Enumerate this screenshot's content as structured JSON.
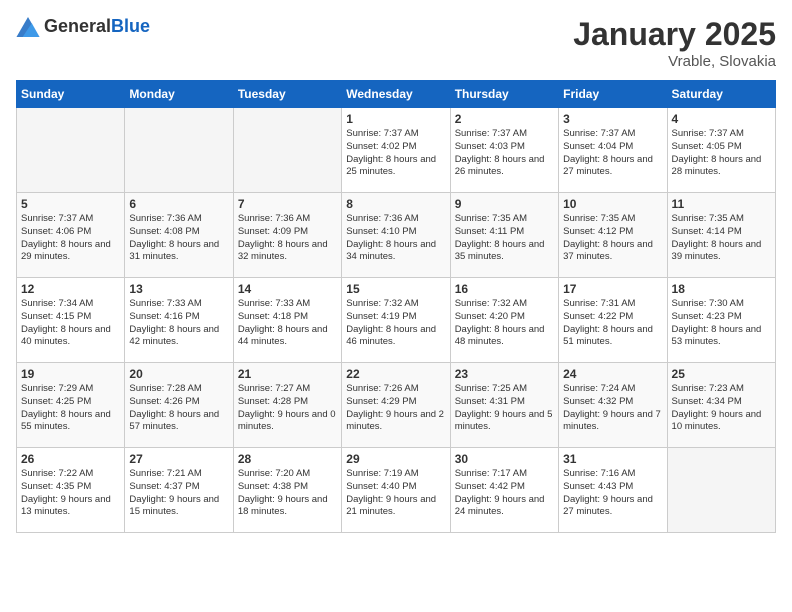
{
  "header": {
    "logo_general": "General",
    "logo_blue": "Blue",
    "title": "January 2025",
    "subtitle": "Vrable, Slovakia"
  },
  "columns": [
    "Sunday",
    "Monday",
    "Tuesday",
    "Wednesday",
    "Thursday",
    "Friday",
    "Saturday"
  ],
  "weeks": [
    [
      {
        "day": "",
        "empty": true
      },
      {
        "day": "",
        "empty": true
      },
      {
        "day": "",
        "empty": true
      },
      {
        "day": "1",
        "sunrise": "7:37 AM",
        "sunset": "4:02 PM",
        "daylight": "8 hours and 25 minutes."
      },
      {
        "day": "2",
        "sunrise": "7:37 AM",
        "sunset": "4:03 PM",
        "daylight": "8 hours and 26 minutes."
      },
      {
        "day": "3",
        "sunrise": "7:37 AM",
        "sunset": "4:04 PM",
        "daylight": "8 hours and 27 minutes."
      },
      {
        "day": "4",
        "sunrise": "7:37 AM",
        "sunset": "4:05 PM",
        "daylight": "8 hours and 28 minutes."
      }
    ],
    [
      {
        "day": "5",
        "sunrise": "7:37 AM",
        "sunset": "4:06 PM",
        "daylight": "8 hours and 29 minutes."
      },
      {
        "day": "6",
        "sunrise": "7:36 AM",
        "sunset": "4:08 PM",
        "daylight": "8 hours and 31 minutes."
      },
      {
        "day": "7",
        "sunrise": "7:36 AM",
        "sunset": "4:09 PM",
        "daylight": "8 hours and 32 minutes."
      },
      {
        "day": "8",
        "sunrise": "7:36 AM",
        "sunset": "4:10 PM",
        "daylight": "8 hours and 34 minutes."
      },
      {
        "day": "9",
        "sunrise": "7:35 AM",
        "sunset": "4:11 PM",
        "daylight": "8 hours and 35 minutes."
      },
      {
        "day": "10",
        "sunrise": "7:35 AM",
        "sunset": "4:12 PM",
        "daylight": "8 hours and 37 minutes."
      },
      {
        "day": "11",
        "sunrise": "7:35 AM",
        "sunset": "4:14 PM",
        "daylight": "8 hours and 39 minutes."
      }
    ],
    [
      {
        "day": "12",
        "sunrise": "7:34 AM",
        "sunset": "4:15 PM",
        "daylight": "8 hours and 40 minutes."
      },
      {
        "day": "13",
        "sunrise": "7:33 AM",
        "sunset": "4:16 PM",
        "daylight": "8 hours and 42 minutes."
      },
      {
        "day": "14",
        "sunrise": "7:33 AM",
        "sunset": "4:18 PM",
        "daylight": "8 hours and 44 minutes."
      },
      {
        "day": "15",
        "sunrise": "7:32 AM",
        "sunset": "4:19 PM",
        "daylight": "8 hours and 46 minutes."
      },
      {
        "day": "16",
        "sunrise": "7:32 AM",
        "sunset": "4:20 PM",
        "daylight": "8 hours and 48 minutes."
      },
      {
        "day": "17",
        "sunrise": "7:31 AM",
        "sunset": "4:22 PM",
        "daylight": "8 hours and 51 minutes."
      },
      {
        "day": "18",
        "sunrise": "7:30 AM",
        "sunset": "4:23 PM",
        "daylight": "8 hours and 53 minutes."
      }
    ],
    [
      {
        "day": "19",
        "sunrise": "7:29 AM",
        "sunset": "4:25 PM",
        "daylight": "8 hours and 55 minutes."
      },
      {
        "day": "20",
        "sunrise": "7:28 AM",
        "sunset": "4:26 PM",
        "daylight": "8 hours and 57 minutes."
      },
      {
        "day": "21",
        "sunrise": "7:27 AM",
        "sunset": "4:28 PM",
        "daylight": "9 hours and 0 minutes."
      },
      {
        "day": "22",
        "sunrise": "7:26 AM",
        "sunset": "4:29 PM",
        "daylight": "9 hours and 2 minutes."
      },
      {
        "day": "23",
        "sunrise": "7:25 AM",
        "sunset": "4:31 PM",
        "daylight": "9 hours and 5 minutes."
      },
      {
        "day": "24",
        "sunrise": "7:24 AM",
        "sunset": "4:32 PM",
        "daylight": "9 hours and 7 minutes."
      },
      {
        "day": "25",
        "sunrise": "7:23 AM",
        "sunset": "4:34 PM",
        "daylight": "9 hours and 10 minutes."
      }
    ],
    [
      {
        "day": "26",
        "sunrise": "7:22 AM",
        "sunset": "4:35 PM",
        "daylight": "9 hours and 13 minutes."
      },
      {
        "day": "27",
        "sunrise": "7:21 AM",
        "sunset": "4:37 PM",
        "daylight": "9 hours and 15 minutes."
      },
      {
        "day": "28",
        "sunrise": "7:20 AM",
        "sunset": "4:38 PM",
        "daylight": "9 hours and 18 minutes."
      },
      {
        "day": "29",
        "sunrise": "7:19 AM",
        "sunset": "4:40 PM",
        "daylight": "9 hours and 21 minutes."
      },
      {
        "day": "30",
        "sunrise": "7:17 AM",
        "sunset": "4:42 PM",
        "daylight": "9 hours and 24 minutes."
      },
      {
        "day": "31",
        "sunrise": "7:16 AM",
        "sunset": "4:43 PM",
        "daylight": "9 hours and 27 minutes."
      },
      {
        "day": "",
        "empty": true
      }
    ]
  ]
}
